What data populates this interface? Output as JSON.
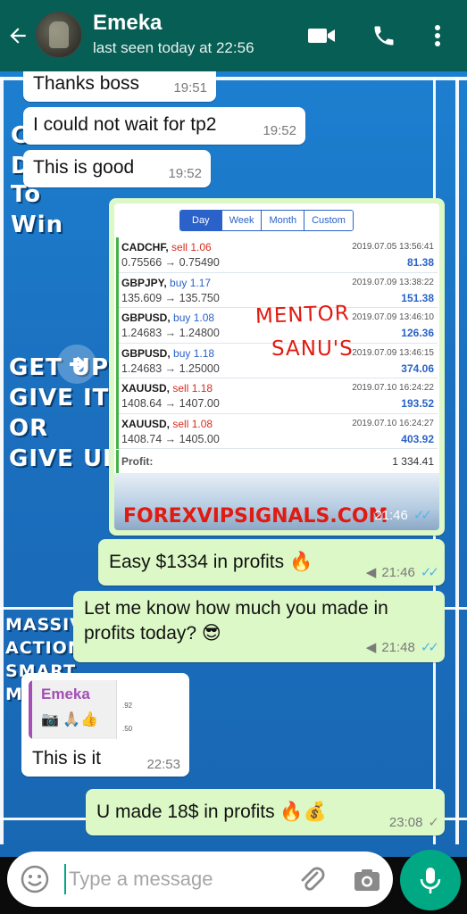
{
  "header": {
    "contact_name": "Emeka",
    "status": "last seen today at 22:56",
    "icons": [
      "back-arrow-icon",
      "video-call-icon",
      "phone-icon",
      "more-vert-icon"
    ]
  },
  "wallpaper": {
    "lines": [
      "C",
      "D",
      "To",
      "Win",
      "GET UP",
      "GIVE IT",
      "OR",
      "GIVE UP",
      "MASSIV",
      "ACTION",
      "SMART",
      "M"
    ]
  },
  "messages": [
    {
      "id": "m1",
      "dir": "in",
      "text": "Thanks boss",
      "time": "19:51"
    },
    {
      "id": "m2",
      "dir": "in",
      "text": "I could not wait for tp2",
      "time": "19:52"
    },
    {
      "id": "m3",
      "dir": "in",
      "text": "This is good",
      "time": "19:52"
    },
    {
      "id": "m5",
      "dir": "out",
      "text": "Easy $1334 in profits 🔥",
      "time": "21:46",
      "ticks": "read"
    },
    {
      "id": "m6",
      "dir": "out",
      "text": "Let me know how much you made in profits today? 😎",
      "time": "21:48",
      "ticks": "read"
    },
    {
      "id": "m7",
      "dir": "in",
      "text": "This is it",
      "time": "22:53",
      "quote": {
        "author": "Emeka",
        "preview": "📷 🙏🏼👍",
        "thumb_values": [
          ".92",
          ".50"
        ]
      }
    },
    {
      "id": "m8",
      "dir": "out",
      "text": "U made 18$ in profits 🔥💰",
      "time": "23:08",
      "ticks": "sent"
    }
  ],
  "image_message": {
    "time": "21:46",
    "ticks": "read",
    "tabs": [
      "Day",
      "Week",
      "Month",
      "Custom"
    ],
    "active_tab": "Day",
    "trades": [
      {
        "symbol": "CADCHF,",
        "side": "sell",
        "volume": "1.06",
        "prices": "0.75566 → 0.75490",
        "date": "2019.07.05 13:56:41",
        "profit": "81.38"
      },
      {
        "symbol": "GBPJPY,",
        "side": "buy",
        "volume": "1.17",
        "prices": "135.609 → 135.750",
        "date": "2019.07.09 13:38:22",
        "profit": "151.38"
      },
      {
        "symbol": "GBPUSD,",
        "side": "buy",
        "volume": "1.08",
        "prices": "1.24683 → 1.24800",
        "date": "2019.07.09 13:46:10",
        "profit": "126.36"
      },
      {
        "symbol": "GBPUSD,",
        "side": "buy",
        "volume": "1.18",
        "prices": "1.24683 → 1.25000",
        "date": "2019.07.09 13:46:15",
        "profit": "374.06"
      },
      {
        "symbol": "XAUUSD,",
        "side": "sell",
        "volume": "1.18",
        "prices": "1408.64 → 1407.00",
        "date": "2019.07.10 16:24:22",
        "profit": "193.52"
      },
      {
        "symbol": "XAUUSD,",
        "side": "sell",
        "volume": "1.08",
        "prices": "1408.74 → 1405.00",
        "date": "2019.07.10 16:24:27",
        "profit": "403.92"
      }
    ],
    "profit_label": "Profit:",
    "profit_total": "1 334.41",
    "watermark_line1": "MENTOR",
    "watermark_line2": "SANU'S",
    "site_watermark": "FOREXVIPSIGNALS.COM"
  },
  "composer": {
    "placeholder": "Type a message",
    "value": ""
  },
  "colors": {
    "header": "#075e54",
    "outgoing_bubble": "#dcf8c6",
    "incoming_bubble": "#ffffff",
    "read_ticks": "#4fb6ec",
    "accent": "#00a884"
  }
}
